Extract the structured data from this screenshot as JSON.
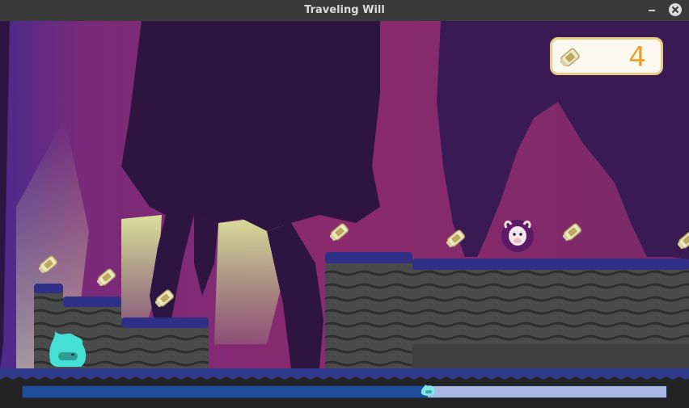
{
  "window": {
    "title": "Traveling Will",
    "minimize_icon": "minimize-icon",
    "close_icon": "close-icon"
  },
  "hud": {
    "coin_icon": "scroll-coin-icon",
    "score": "4"
  },
  "progress": {
    "fraction": 0.63
  },
  "colors": {
    "sky_left": "#4a2a8c",
    "sky": "#8b2a6e",
    "silhouette": "#2e1440",
    "ground_top": "#2f2f85",
    "rock": "#4a4a4a",
    "player": "#44e0d6",
    "score_text": "#e6a22a",
    "progress_fill": "#1d4e9a",
    "progress_track": "#a9b9e3"
  }
}
